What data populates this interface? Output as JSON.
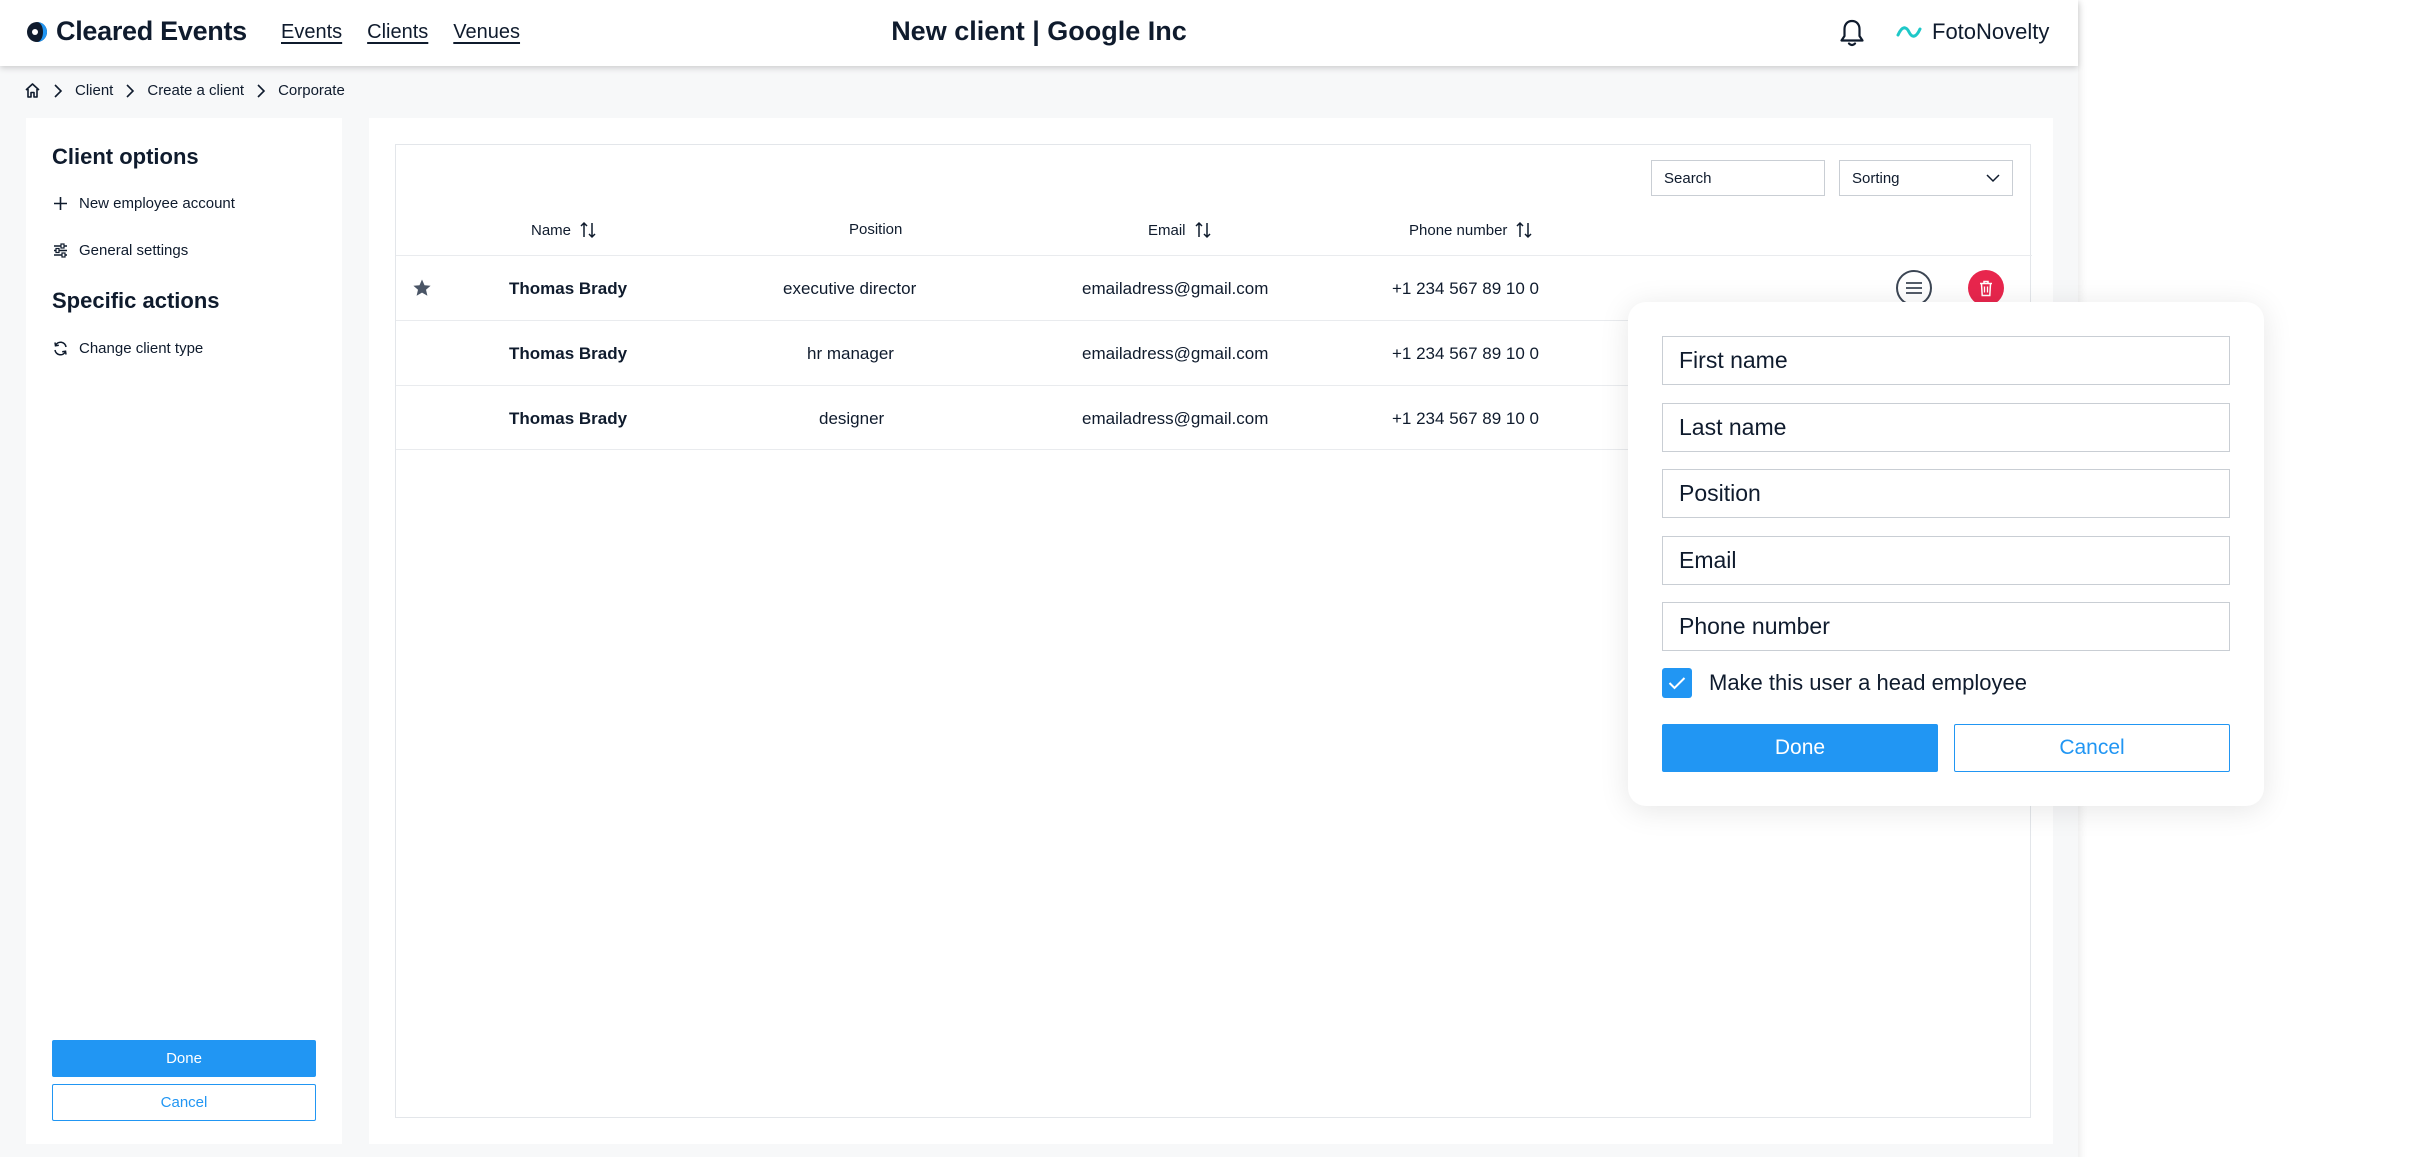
{
  "header": {
    "logo_text": "Cleared Events",
    "nav": [
      "Events",
      "Clients",
      "Venues"
    ],
    "title": "New client | Google Inc",
    "brand": "FotoNovelty",
    "icons": {
      "logo": "logo-icon",
      "bell": "bell-icon",
      "brand": "wave-icon"
    }
  },
  "breadcrumb": [
    "Client",
    "Create a client",
    "Corporate"
  ],
  "sidebar": {
    "client_options_heading": "Client options",
    "client_options": [
      {
        "label": "New employee account",
        "icon": "plus-icon"
      },
      {
        "label": "General settings",
        "icon": "sliders-icon"
      }
    ],
    "specific_actions_heading": "Specific actions",
    "specific_actions": [
      {
        "label": "Change client type",
        "icon": "refresh-icon"
      }
    ],
    "done_label": "Done",
    "cancel_label": "Cancel"
  },
  "table": {
    "search_placeholder": "Search",
    "sorting_label": "Sorting",
    "columns": [
      "Name",
      "Position",
      "Email",
      "Phone number"
    ],
    "rows": [
      {
        "name": "Thomas Brady",
        "position": "executive director",
        "email": "emailadress@gmail.com",
        "phone": "+1 234 567 89 10 0",
        "starred": true
      },
      {
        "name": "Thomas Brady",
        "position": "hr manager",
        "email": "emailadress@gmail.com",
        "phone": "+1 234 567 89 10 0",
        "starred": false
      },
      {
        "name": "Thomas Brady",
        "position": "designer",
        "email": "emailadress@gmail.com",
        "phone": "+1 234 567 89 10 0",
        "starred": false
      }
    ]
  },
  "popup": {
    "first_name_placeholder": "First name",
    "last_name_placeholder": "Last name",
    "position_placeholder": "Position",
    "email_placeholder": "Email",
    "phone_placeholder": "Phone number",
    "head_employee_label": "Make this user a head employee",
    "head_employee_checked": true,
    "done_label": "Done",
    "cancel_label": "Cancel"
  },
  "colors": {
    "primary": "#2196f3",
    "danger": "#e8264d",
    "text": "#0f1b2d",
    "brand_wave": "#1ec8c8"
  }
}
